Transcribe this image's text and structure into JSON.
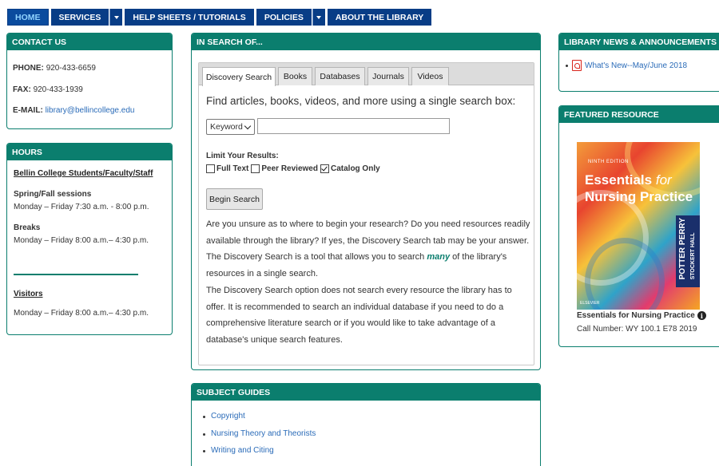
{
  "nav": {
    "home": "HOME",
    "services": "SERVICES",
    "help": "HELP SHEETS / TUTORIALS",
    "policies": "POLICIES",
    "about": "ABOUT THE LIBRARY"
  },
  "contact": {
    "title": "CONTACT US",
    "phone_label": "PHONE:",
    "phone": "920-433-6659",
    "fax_label": "FAX:",
    "fax": "920-433-1939",
    "email_label": "E-MAIL:",
    "email": "library@bellincollege.edu"
  },
  "hours": {
    "title": "HOURS",
    "group": "Bellin College Students/Faculty/Staff",
    "spring_label": "Spring/Fall sessions",
    "spring_hours": "Monday – Friday 7:30 a.m. - 8:00 p.m.",
    "breaks_label": "Breaks",
    "breaks_hours": "Monday – Friday 8:00 a.m.– 4:30 p.m.",
    "visitors_label": "Visitors",
    "visitors_hours": "Monday – Friday 8:00 a.m.– 4:30 p.m."
  },
  "search": {
    "title": "IN SEARCH OF...",
    "tabs": [
      "Discovery Search",
      "Books",
      "Databases",
      "Journals",
      "Videos"
    ],
    "lead": "Find articles, books, videos, and more using a single search box:",
    "select_value": "Keyword",
    "input_value": "",
    "limit_label": "Limit Your Results:",
    "checks": {
      "full_text": "Full Text",
      "peer_reviewed": "Peer Reviewed",
      "catalog_only": "Catalog Only"
    },
    "button": "Begin Search",
    "para1_a": "Are you unsure as to where to begin your research?  Do you need resources readily available through the library?  If yes, the Discovery Search tab may be your answer.  The Discovery Search is a tool that allows you to search ",
    "para1_many": "many",
    "para1_b": " of the library's resources in a single search.",
    "para2": "The Discovery Search option does not search every resource the library has to offer.  It is recommended to search an individual database if you need to do a comprehensive literature search or if you would like to take advantage of a database's unique search features."
  },
  "subject_guides": {
    "title": "SUBJECT GUIDES",
    "items": [
      "Copyright",
      "Nursing Theory and Theorists",
      "Writing and Citing"
    ]
  },
  "news": {
    "title": "LIBRARY NEWS & ANNOUNCEMENTS",
    "item": "What's New--May/June 2018"
  },
  "featured": {
    "title": "FEATURED RESOURCE",
    "cover_edition": "NINTH EDITION",
    "cover_title_1": "Essentials",
    "cover_title_for": "for",
    "cover_title_2": "Nursing Practice",
    "cover_authors_1": "POTTER  PERRY",
    "cover_authors_2": "STOCKERT  HALL",
    "cover_publisher": "ELSEVIER",
    "book_title": "Essentials for Nursing Practice",
    "call_number": "Call Number: WY 100.1 E78 2019"
  }
}
